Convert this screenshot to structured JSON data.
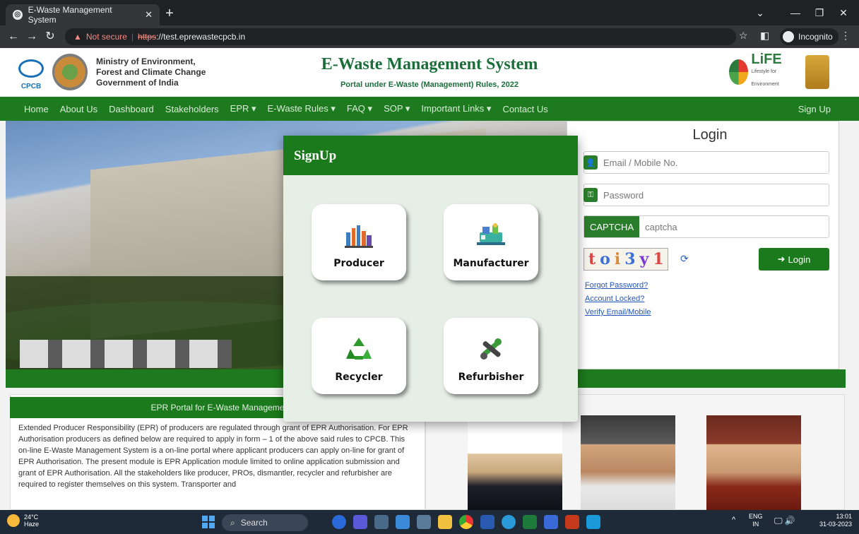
{
  "browser": {
    "tab_title": "E-Waste Management System",
    "url_warning": "Not secure",
    "url_scheme": "https",
    "url_rest": "://test.eprewastecpcb.in",
    "incognito_label": "Incognito"
  },
  "header": {
    "cpcb_text": "CPCB",
    "ministry_line1": "Ministry of Environment,",
    "ministry_line2": "Forest and Climate Change",
    "ministry_line3": "Government of India",
    "title": "E-Waste Management System",
    "subtitle": "Portal under E-Waste (Management) Rules, 2022",
    "life_text": "LiFE",
    "life_sub": "Lifestyle for Environment"
  },
  "nav": {
    "items": [
      "Home",
      "About Us",
      "Dashboard",
      "Stakeholders",
      "EPR ▾",
      "E-Waste Rules ▾",
      "FAQ ▾",
      "SOP ▾",
      "Important Links ▾",
      "Contact Us"
    ],
    "signup": "Sign Up"
  },
  "login": {
    "title": "Login",
    "email_placeholder": "Email / Mobile No.",
    "password_placeholder": "Password",
    "captcha_label": "CAPTCHA",
    "captcha_placeholder": "captcha",
    "captcha_chars": [
      "t",
      "o",
      "i",
      "3",
      "y",
      "1"
    ],
    "login_button": "Login",
    "links": [
      "Forgot Password?",
      "Account Locked?",
      "Verify Email/Mobile"
    ]
  },
  "epr": {
    "header": "EPR Portal for E-Waste Manageme",
    "body": "Extended Producer Responsibility (EPR) of producers are regulated through grant of EPR Authorisation. For EPR Authorisation producers as defined below are required to apply in form – 1 of the above said rules to CPCB. This on-line E-Waste Management System is a on-line portal where applicant producers can apply on-line for grant of EPR Authorisation. The present module is EPR Application module limited to online application submission and grant of EPR Authorisation. All the stakeholders like producer, PROs, dismantler, recycler and refurbisher are required to register themselves on this system. Transporter and"
  },
  "modal": {
    "title": "SignUp",
    "close": "×",
    "cards": [
      {
        "label": "Producer",
        "icon": "factory-icon"
      },
      {
        "label": "Manufacturer",
        "icon": "machinery-icon"
      },
      {
        "label": "Recycler",
        "icon": "recycle-icon"
      },
      {
        "label": "Refurbisher",
        "icon": "tools-icon"
      }
    ]
  },
  "taskbar": {
    "weather_temp": "24°C",
    "weather_desc": "Haze",
    "search_label": "Search",
    "lang_line1": "ENG",
    "lang_line2": "IN",
    "time": "13:01",
    "date": "31-03-2023"
  },
  "colors": {
    "brand_green": "#1b7a1b",
    "modal_bg": "#e6efe6",
    "link_blue": "#2255bb"
  }
}
